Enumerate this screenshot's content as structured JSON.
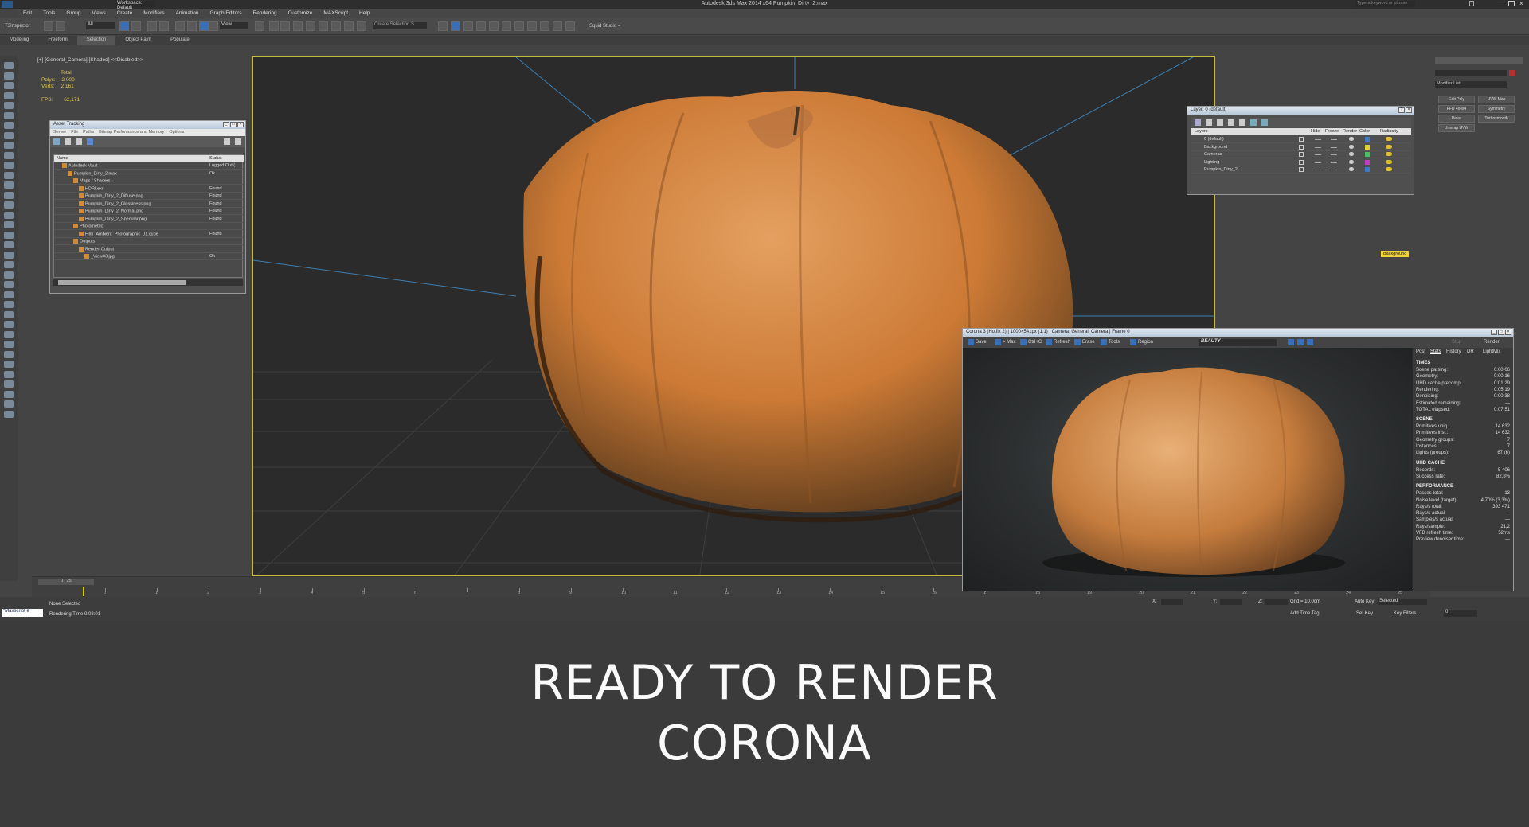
{
  "window": {
    "title": "Autodesk 3ds Max 2014 x64    Pumpkin_Dirty_2.max",
    "search_placeholder": "Type a keyword or phrase",
    "workspace": "Workspace: Default"
  },
  "menu": [
    "Edit",
    "Tools",
    "Group",
    "Views",
    "Create",
    "Modifiers",
    "Animation",
    "Graph Editors",
    "Rendering",
    "Customize",
    "MAXScript",
    "Help"
  ],
  "toolbar": {
    "left_label": "T3Inspector",
    "filter": "All",
    "view": "View",
    "create_selection": "Create Selection S",
    "plugin": "Squid Studio ="
  },
  "ribbon": [
    "Modeling",
    "Freeform",
    "Selection",
    "Object Paint",
    "Populate"
  ],
  "ribbon_active": "Selection",
  "viewport": {
    "label": "[+] [General_Camera] [Shaded] <<Disabled>>",
    "stats_total": "Total",
    "polys_label": "Polys:",
    "polys": "2 000",
    "verts_label": "Verts:",
    "verts": "2 161",
    "fps_label": "FPS:",
    "fps": "62,171"
  },
  "asset_tracking": {
    "title": "Asset Tracking",
    "menu": [
      "Server",
      "File",
      "Paths",
      "Bitmap Performance and Memory",
      "Options"
    ],
    "col_name": "Name",
    "col_status": "Status",
    "rows": [
      {
        "name": "Autodesk Vault",
        "status": "Logged Out (...",
        "indent": 1
      },
      {
        "name": "Pumpkin_Dirty_2.max",
        "status": "Ok",
        "indent": 2
      },
      {
        "name": "Maps / Shaders",
        "status": "",
        "indent": 3
      },
      {
        "name": "HDRI.exr",
        "status": "Found",
        "indent": 4
      },
      {
        "name": "Pumpkin_Dirty_2_Diffuse.png",
        "status": "Found",
        "indent": 4
      },
      {
        "name": "Pumpkin_Dirty_2_Glossiness.png",
        "status": "Found",
        "indent": 4
      },
      {
        "name": "Pumpkin_Dirty_2_Normal.png",
        "status": "Found",
        "indent": 4
      },
      {
        "name": "Pumpkin_Dirty_2_Specular.png",
        "status": "Found",
        "indent": 4
      },
      {
        "name": "Photometric",
        "status": "",
        "indent": 3
      },
      {
        "name": "Film_Ambient_Photographic_01.cube",
        "status": "Found",
        "indent": 4
      },
      {
        "name": "Outputs",
        "status": "",
        "indent": 3
      },
      {
        "name": "Render Output",
        "status": "",
        "indent": 4
      },
      {
        "name": "_View03.jpg",
        "status": "Ok",
        "indent": 5
      }
    ]
  },
  "layers": {
    "title": "Layer: 0 (default)",
    "headers": [
      "Layers",
      "Hide",
      "Freeze",
      "Render",
      "Color",
      "Radiosity"
    ],
    "rows": [
      "0 (default)",
      "Background",
      "Cameras",
      "Lighting",
      "Pumpkin_Dirty_2"
    ]
  },
  "background_tag": "Background",
  "right_panel": {
    "modifier_list": "Modifier List",
    "buttons": [
      "Edit Poly",
      "UVW Map",
      "FFD 4x4x4",
      "Symmetry",
      "Relax",
      "Turbosmooth",
      "Unwrap UVW"
    ]
  },
  "vfb": {
    "title": "Corona 3 (Hotfix 2) | 1000×541px (1:1) | Camera: General_Camera | Frame 0",
    "toolbar": [
      "Save",
      "> Max",
      "Ctrl+C",
      "Refresh",
      "Erase",
      "Tools",
      "Region"
    ],
    "channel": "BEAUTY",
    "stop": "Stop",
    "render": "Render",
    "tabs": [
      "Post",
      "Stats",
      "History",
      "DR",
      "LightMix"
    ],
    "times_header": "TIMES",
    "times": [
      [
        "Scene parsing:",
        "0:00:06"
      ],
      [
        "Geometry:",
        "0:00:16"
      ],
      [
        "UHD cache precomp:",
        "0:01:29"
      ],
      [
        "Rendering:",
        "0:05:19"
      ],
      [
        "Denoising:",
        "0:00:38"
      ],
      [
        "Estimated remaining:",
        "—"
      ],
      [
        "TOTAL elapsed:",
        "0:07:51"
      ]
    ],
    "scene_header": "SCENE",
    "scene": [
      [
        "Primitives uniq.:",
        "14 632"
      ],
      [
        "Primitives inst.:",
        "14 632"
      ],
      [
        "Geometry groups:",
        "7"
      ],
      [
        "Instances:",
        "7"
      ],
      [
        "Lights (groups):",
        "67 (6)"
      ]
    ],
    "uhd_header": "UHD CACHE",
    "uhd": [
      [
        "Records:",
        "5 406"
      ],
      [
        "Success rate:",
        "82,8%"
      ]
    ],
    "perf_header": "PERFORMANCE",
    "perf": [
      [
        "Passes total:",
        "13"
      ],
      [
        "Noise level (target):",
        "4,70% (3,3%)"
      ],
      [
        "Rays/s total:",
        "393 471"
      ],
      [
        "Rays/s actual:",
        "—"
      ],
      [
        "Samples/s actual:",
        "—"
      ],
      [
        "Rays/sample:",
        "21,2"
      ],
      [
        "VFB refresh time:",
        "52ms"
      ],
      [
        "Preview denoiser time:",
        "—"
      ]
    ]
  },
  "timeline": {
    "frame": "0 / 25",
    "ticks": [
      "0",
      "1",
      "2",
      "3",
      "4",
      "5",
      "6",
      "7",
      "8",
      "9",
      "10",
      "11",
      "12",
      "13",
      "14",
      "15",
      "16",
      "17",
      "18",
      "19",
      "20",
      "21",
      "22",
      "23",
      "24",
      "25"
    ]
  },
  "status": {
    "selection": "None Selected",
    "render_time": "Rendering Time  0:08:01",
    "maxscript": "\"Maxscript e",
    "x": "X:",
    "y": "Y:",
    "z": "Z:",
    "grid": "Grid = 10,0cm",
    "add_time_tag": "Add Time Tag",
    "auto_key": "Auto Key",
    "selected": "Selected",
    "set_key": "Set Key",
    "key_filters": "Key Filters...",
    "frame_field": "0"
  },
  "caption": {
    "line1": "READY TO RENDER",
    "line2": "CORONA"
  },
  "colors": {
    "viewport_border": "#c8bc3c",
    "accent_blue": "#3a6fb5",
    "pumpkin": "#d0853a",
    "stats_yellow": "#e2c84a"
  }
}
